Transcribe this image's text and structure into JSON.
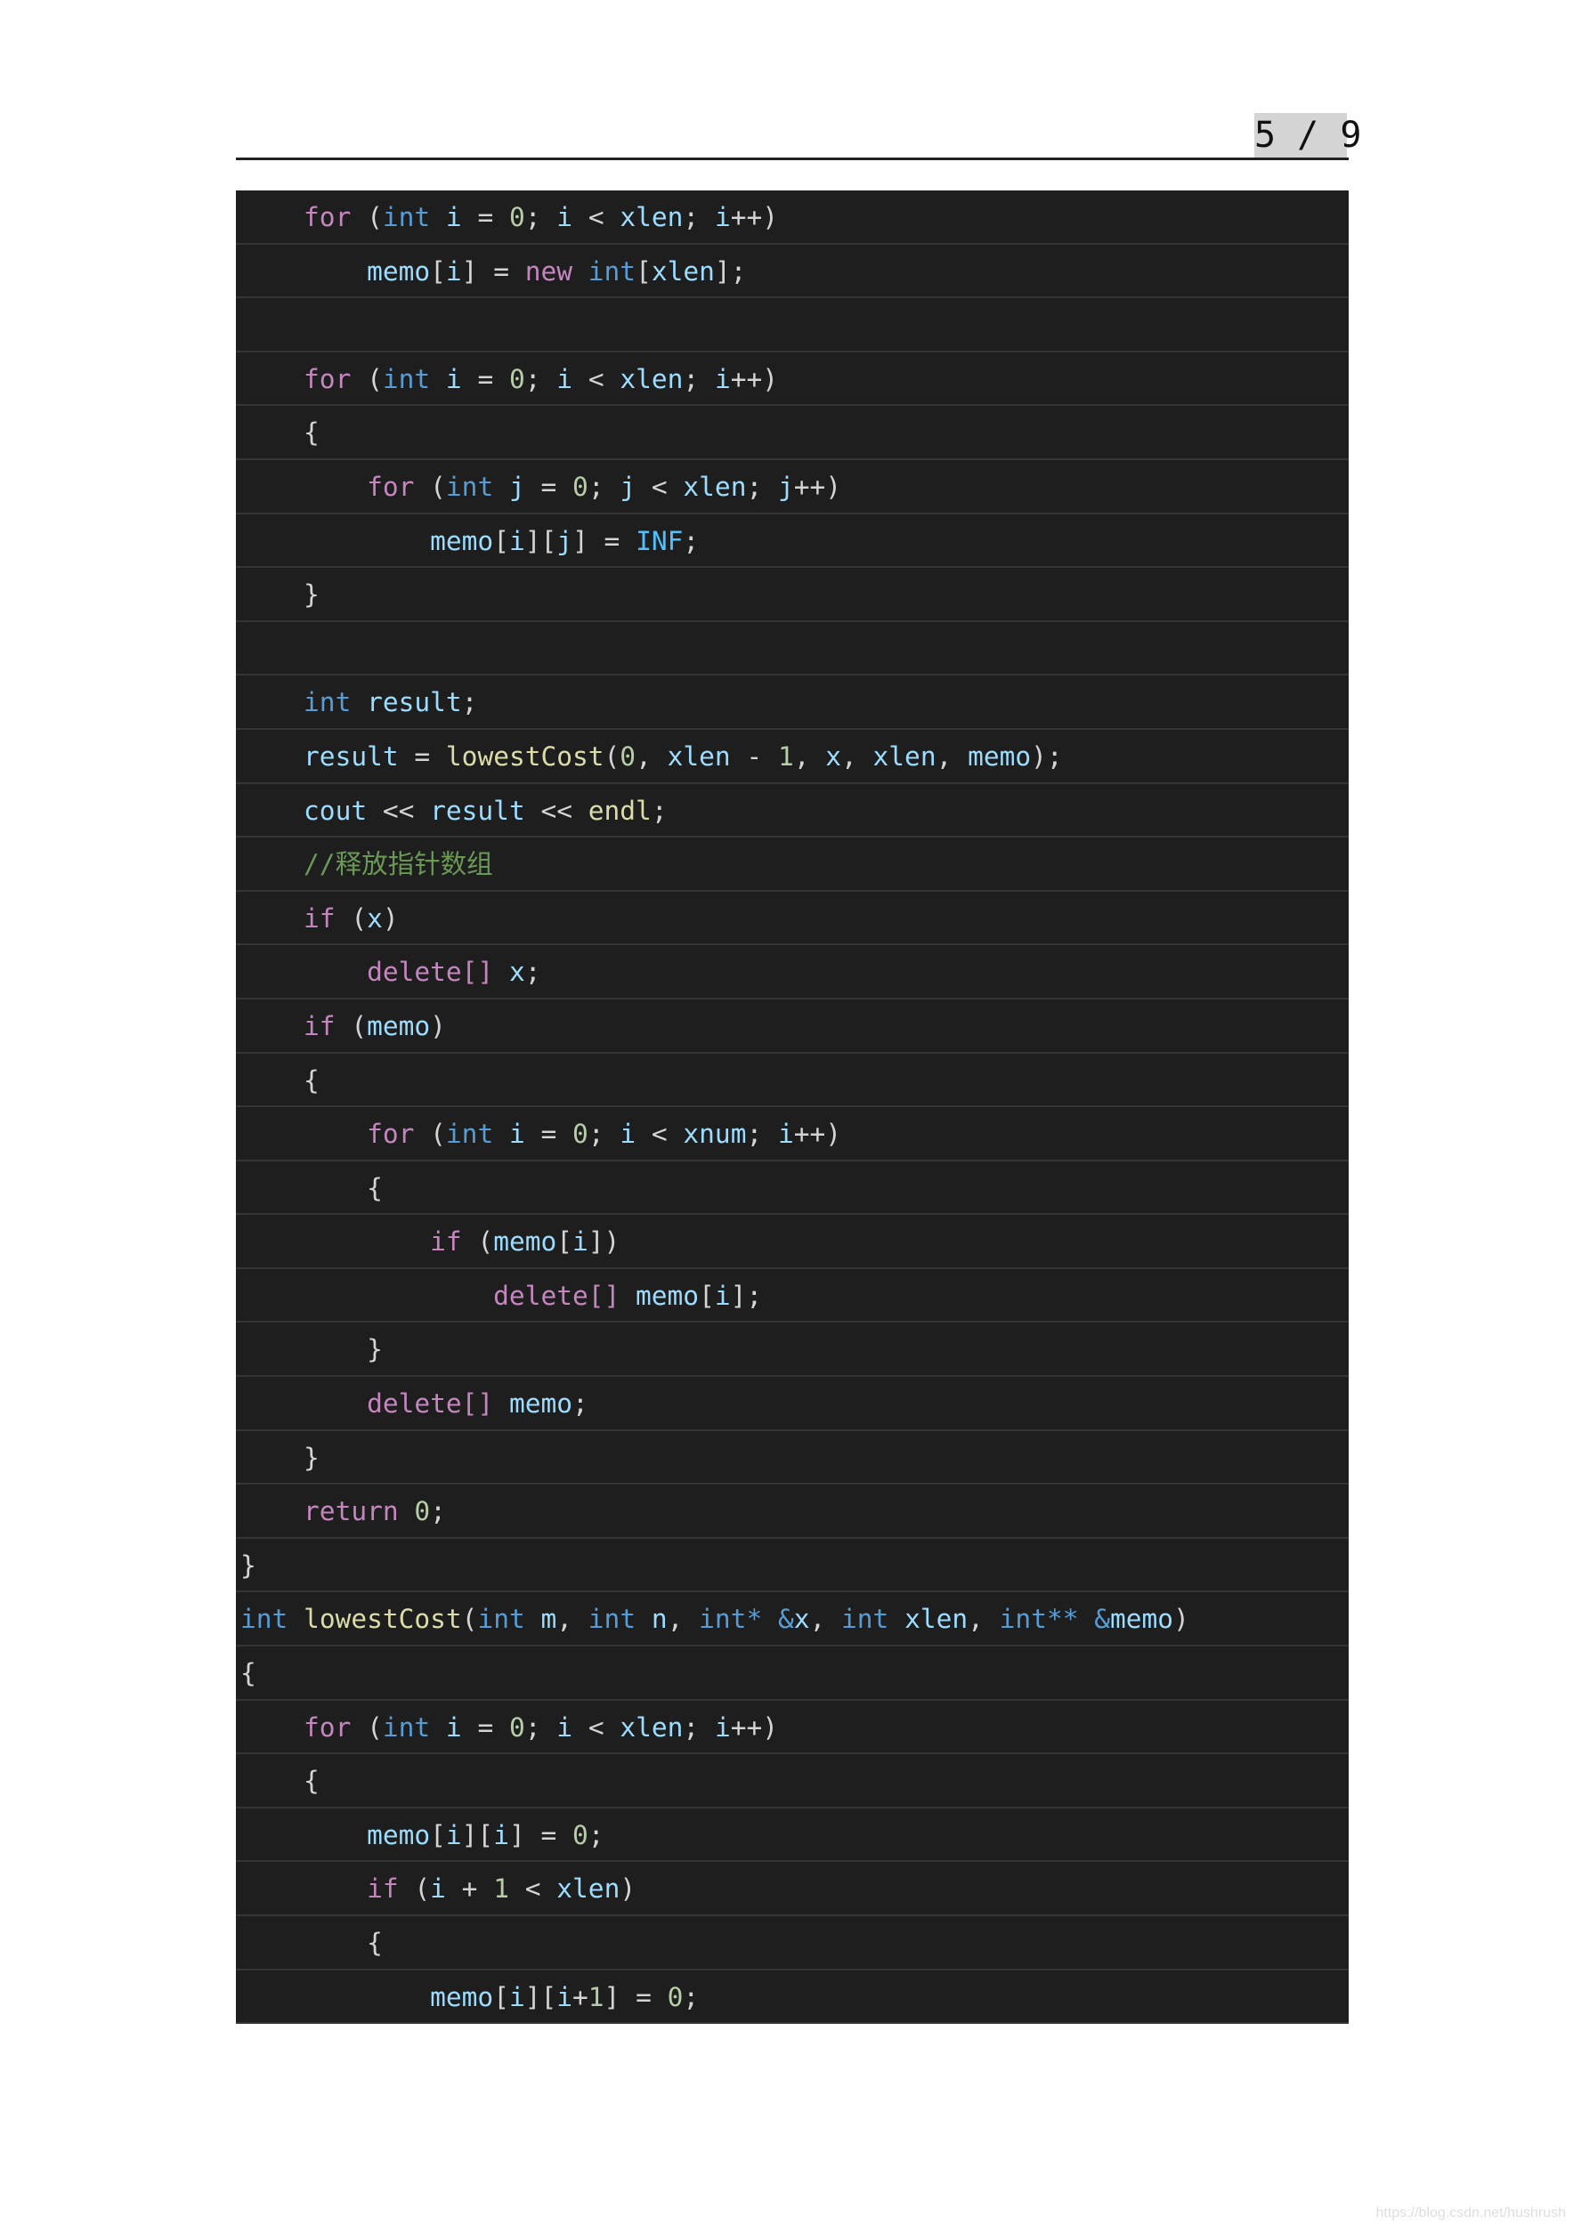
{
  "header": {
    "page_indicator": "5 / 9"
  },
  "code_lines": [
    [
      [
        "p",
        "    "
      ],
      [
        "k",
        "for"
      ],
      [
        "p",
        " ("
      ],
      [
        "t",
        "int"
      ],
      [
        "v",
        " i"
      ],
      [
        "p",
        " = "
      ],
      [
        "n",
        "0"
      ],
      [
        "p",
        "; "
      ],
      [
        "v",
        "i"
      ],
      [
        "p",
        " < "
      ],
      [
        "v",
        "xlen"
      ],
      [
        "p",
        "; "
      ],
      [
        "v",
        "i"
      ],
      [
        "p",
        "++)"
      ]
    ],
    [
      [
        "p",
        "        "
      ],
      [
        "v",
        "memo"
      ],
      [
        "p",
        "["
      ],
      [
        "v",
        "i"
      ],
      [
        "p",
        "] = "
      ],
      [
        "k",
        "new"
      ],
      [
        "p",
        " "
      ],
      [
        "t",
        "int"
      ],
      [
        "p",
        "["
      ],
      [
        "v",
        "xlen"
      ],
      [
        "p",
        "];"
      ]
    ],
    [],
    [
      [
        "p",
        "    "
      ],
      [
        "k",
        "for"
      ],
      [
        "p",
        " ("
      ],
      [
        "t",
        "int"
      ],
      [
        "v",
        " i"
      ],
      [
        "p",
        " = "
      ],
      [
        "n",
        "0"
      ],
      [
        "p",
        "; "
      ],
      [
        "v",
        "i"
      ],
      [
        "p",
        " < "
      ],
      [
        "v",
        "xlen"
      ],
      [
        "p",
        "; "
      ],
      [
        "v",
        "i"
      ],
      [
        "p",
        "++)"
      ]
    ],
    [
      [
        "p",
        "    {"
      ]
    ],
    [
      [
        "p",
        "        "
      ],
      [
        "k",
        "for"
      ],
      [
        "p",
        " ("
      ],
      [
        "t",
        "int"
      ],
      [
        "v",
        " j"
      ],
      [
        "p",
        " = "
      ],
      [
        "n",
        "0"
      ],
      [
        "p",
        "; "
      ],
      [
        "v",
        "j"
      ],
      [
        "p",
        " < "
      ],
      [
        "v",
        "xlen"
      ],
      [
        "p",
        "; "
      ],
      [
        "v",
        "j"
      ],
      [
        "p",
        "++)"
      ]
    ],
    [
      [
        "p",
        "            "
      ],
      [
        "v",
        "memo"
      ],
      [
        "p",
        "["
      ],
      [
        "v",
        "i"
      ],
      [
        "p",
        "]["
      ],
      [
        "v",
        "j"
      ],
      [
        "p",
        "] = "
      ],
      [
        "s",
        "INF"
      ],
      [
        "p",
        ";"
      ]
    ],
    [
      [
        "p",
        "    }"
      ]
    ],
    [],
    [
      [
        "p",
        "    "
      ],
      [
        "t",
        "int"
      ],
      [
        "v",
        " result"
      ],
      [
        "p",
        ";"
      ]
    ],
    [
      [
        "p",
        "    "
      ],
      [
        "v",
        "result"
      ],
      [
        "p",
        " = "
      ],
      [
        "f",
        "lowestCost"
      ],
      [
        "p",
        "("
      ],
      [
        "n",
        "0"
      ],
      [
        "p",
        ", "
      ],
      [
        "v",
        "xlen"
      ],
      [
        "p",
        " - "
      ],
      [
        "n",
        "1"
      ],
      [
        "p",
        ", "
      ],
      [
        "v",
        "x"
      ],
      [
        "p",
        ", "
      ],
      [
        "v",
        "xlen"
      ],
      [
        "p",
        ", "
      ],
      [
        "v",
        "memo"
      ],
      [
        "p",
        ");"
      ]
    ],
    [
      [
        "p",
        "    "
      ],
      [
        "v",
        "cout"
      ],
      [
        "p",
        " << "
      ],
      [
        "v",
        "result"
      ],
      [
        "p",
        " << "
      ],
      [
        "f",
        "endl"
      ],
      [
        "p",
        ";"
      ]
    ],
    [
      [
        "p",
        "    "
      ],
      [
        "c",
        "//释放指针数组"
      ]
    ],
    [
      [
        "p",
        "    "
      ],
      [
        "k",
        "if"
      ],
      [
        "p",
        " ("
      ],
      [
        "v",
        "x"
      ],
      [
        "p",
        ")"
      ]
    ],
    [
      [
        "p",
        "        "
      ],
      [
        "k",
        "delete[]"
      ],
      [
        "v",
        " x"
      ],
      [
        "p",
        ";"
      ]
    ],
    [
      [
        "p",
        "    "
      ],
      [
        "k",
        "if"
      ],
      [
        "p",
        " ("
      ],
      [
        "v",
        "memo"
      ],
      [
        "p",
        ")"
      ]
    ],
    [
      [
        "p",
        "    {"
      ]
    ],
    [
      [
        "p",
        "        "
      ],
      [
        "k",
        "for"
      ],
      [
        "p",
        " ("
      ],
      [
        "t",
        "int"
      ],
      [
        "v",
        " i"
      ],
      [
        "p",
        " = "
      ],
      [
        "n",
        "0"
      ],
      [
        "p",
        "; "
      ],
      [
        "v",
        "i"
      ],
      [
        "p",
        " < "
      ],
      [
        "v",
        "xnum"
      ],
      [
        "p",
        "; "
      ],
      [
        "v",
        "i"
      ],
      [
        "p",
        "++)"
      ]
    ],
    [
      [
        "p",
        "        {"
      ]
    ],
    [
      [
        "p",
        "            "
      ],
      [
        "k",
        "if"
      ],
      [
        "p",
        " ("
      ],
      [
        "v",
        "memo"
      ],
      [
        "p",
        "["
      ],
      [
        "v",
        "i"
      ],
      [
        "p",
        "])"
      ]
    ],
    [
      [
        "p",
        "                "
      ],
      [
        "k",
        "delete[]"
      ],
      [
        "v",
        " memo"
      ],
      [
        "p",
        "["
      ],
      [
        "v",
        "i"
      ],
      [
        "p",
        "];"
      ]
    ],
    [
      [
        "p",
        "        }"
      ]
    ],
    [
      [
        "p",
        "        "
      ],
      [
        "k",
        "delete[]"
      ],
      [
        "v",
        " memo"
      ],
      [
        "p",
        ";"
      ]
    ],
    [
      [
        "p",
        "    }"
      ]
    ],
    [
      [
        "p",
        "    "
      ],
      [
        "k",
        "return"
      ],
      [
        "p",
        " "
      ],
      [
        "n",
        "0"
      ],
      [
        "p",
        ";"
      ]
    ],
    [
      [
        "p",
        "}"
      ]
    ],
    [
      [
        "t",
        "int"
      ],
      [
        "p",
        " "
      ],
      [
        "f",
        "lowestCost"
      ],
      [
        "p",
        "("
      ],
      [
        "t",
        "int"
      ],
      [
        "v",
        " m"
      ],
      [
        "p",
        ", "
      ],
      [
        "t",
        "int"
      ],
      [
        "v",
        " n"
      ],
      [
        "p",
        ", "
      ],
      [
        "t",
        "int*"
      ],
      [
        "p",
        " "
      ],
      [
        "t",
        "&"
      ],
      [
        "v",
        "x"
      ],
      [
        "p",
        ", "
      ],
      [
        "t",
        "int"
      ],
      [
        "v",
        " xlen"
      ],
      [
        "p",
        ", "
      ],
      [
        "t",
        "int**"
      ],
      [
        "p",
        " "
      ],
      [
        "t",
        "&"
      ],
      [
        "v",
        "memo"
      ],
      [
        "p",
        ")"
      ]
    ],
    [
      [
        "p",
        "{"
      ]
    ],
    [
      [
        "p",
        "    "
      ],
      [
        "k",
        "for"
      ],
      [
        "p",
        " ("
      ],
      [
        "t",
        "int"
      ],
      [
        "v",
        " i"
      ],
      [
        "p",
        " = "
      ],
      [
        "n",
        "0"
      ],
      [
        "p",
        "; "
      ],
      [
        "v",
        "i"
      ],
      [
        "p",
        " < "
      ],
      [
        "v",
        "xlen"
      ],
      [
        "p",
        "; "
      ],
      [
        "v",
        "i"
      ],
      [
        "p",
        "++)"
      ]
    ],
    [
      [
        "p",
        "    {"
      ]
    ],
    [
      [
        "p",
        "        "
      ],
      [
        "v",
        "memo"
      ],
      [
        "p",
        "["
      ],
      [
        "v",
        "i"
      ],
      [
        "p",
        "]["
      ],
      [
        "v",
        "i"
      ],
      [
        "p",
        "] = "
      ],
      [
        "n",
        "0"
      ],
      [
        "p",
        ";"
      ]
    ],
    [
      [
        "p",
        "        "
      ],
      [
        "k",
        "if"
      ],
      [
        "p",
        " ("
      ],
      [
        "v",
        "i"
      ],
      [
        "p",
        " + "
      ],
      [
        "n",
        "1"
      ],
      [
        "p",
        " < "
      ],
      [
        "v",
        "xlen"
      ],
      [
        "p",
        ")"
      ]
    ],
    [
      [
        "p",
        "        {"
      ]
    ],
    [
      [
        "p",
        "            "
      ],
      [
        "v",
        "memo"
      ],
      [
        "p",
        "["
      ],
      [
        "v",
        "i"
      ],
      [
        "p",
        "]["
      ],
      [
        "v",
        "i"
      ],
      [
        "p",
        "+"
      ],
      [
        "n",
        "1"
      ],
      [
        "p",
        "] = "
      ],
      [
        "n",
        "0"
      ],
      [
        "p",
        ";"
      ]
    ]
  ],
  "colors": {
    "background": "#1e1e1e",
    "keyword": "#c586c0",
    "type": "#569cd6",
    "variable": "#9cdcfe",
    "number": "#b5cea8",
    "function": "#dcdcaa",
    "comment": "#6a9955"
  },
  "watermark": "https://blog.csdn.net/hushrush"
}
